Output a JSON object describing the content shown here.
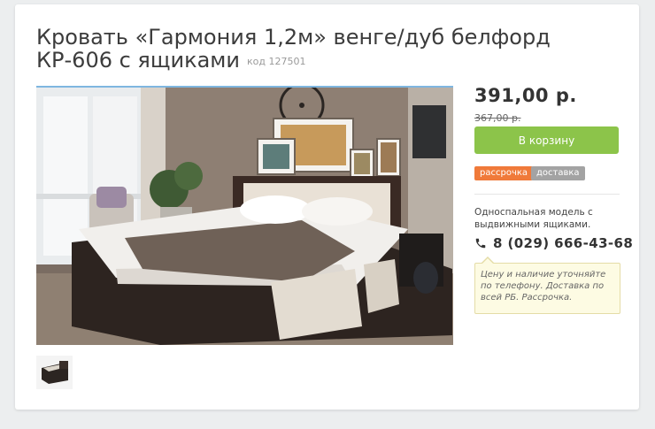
{
  "product": {
    "title": "Кровать «Гармония 1,2м» венге/дуб белфорд КР-606 с ящиками",
    "code": "код 127501",
    "price": "391,00 р.",
    "old_price": "367,00 р.",
    "cart_button": "В корзину",
    "tags": [
      "рассрочка",
      "доставка"
    ],
    "description": "Односпальная модель с выдвижными ящиками.",
    "phone": "8 (029) 666-43-68",
    "note": "Цену и наличие уточняйте по телефону. Доставка по всей РБ. Рассрочка."
  },
  "icons": {
    "phone": "phone-icon"
  },
  "colors": {
    "cart_button": "#8cc44a",
    "tag_installment": "#f07a3a",
    "tag_delivery": "#a3a3a3",
    "note_background": "#fdfbe3"
  }
}
